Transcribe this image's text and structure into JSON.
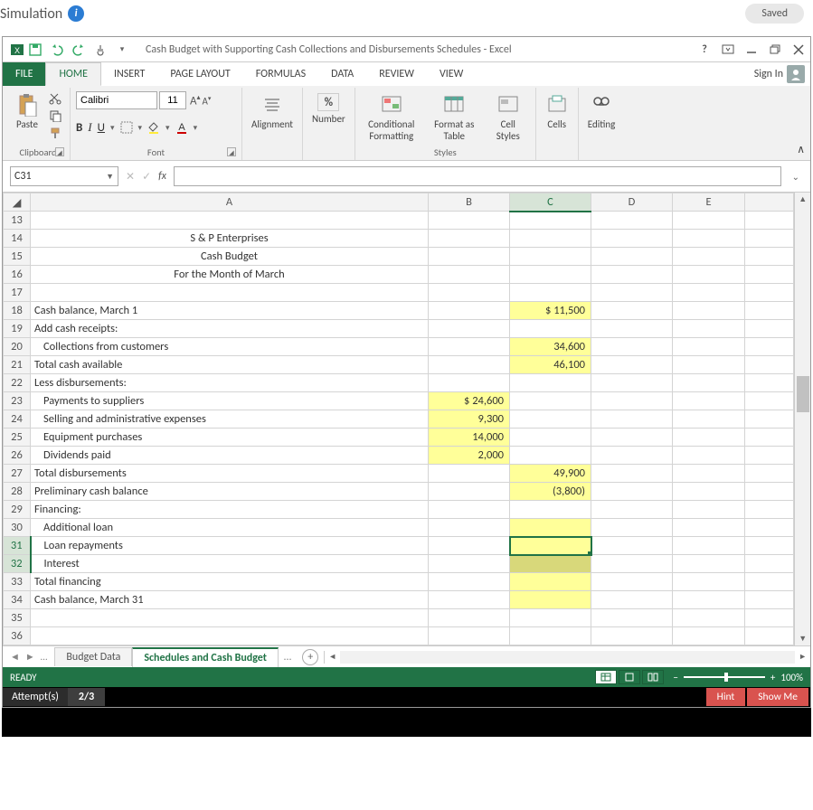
{
  "page": {
    "title": "Simulation",
    "saved_label": "Saved"
  },
  "titlebar": {
    "doc_title": "Cash Budget with Supporting Cash Collections and Disbursements Schedules - Excel"
  },
  "ribbon_tabs": {
    "file": "FILE",
    "home": "HOME",
    "insert": "INSERT",
    "page_layout": "PAGE LAYOUT",
    "formulas": "FORMULAS",
    "data": "DATA",
    "review": "REVIEW",
    "view": "VIEW",
    "sign_in": "Sign In"
  },
  "ribbon": {
    "clipboard": {
      "paste": "Paste",
      "group_label": "Clipboard"
    },
    "font": {
      "name": "Calibri",
      "size": "11",
      "group_label": "Font"
    },
    "alignment": {
      "label": "Alignment"
    },
    "number": {
      "label": "Number",
      "percent": "%"
    },
    "styles": {
      "cond": "Conditional Formatting",
      "table": "Format as Table",
      "cell": "Cell Styles",
      "group_label": "Styles"
    },
    "cells": {
      "label": "Cells"
    },
    "editing": {
      "label": "Editing"
    }
  },
  "formula_bar": {
    "name_box": "C31",
    "formula": ""
  },
  "columns": [
    "A",
    "B",
    "C",
    "D",
    "E"
  ],
  "active_col_index": 2,
  "rows": [
    {
      "n": 13,
      "a": "",
      "b": "",
      "c": "",
      "d": "",
      "e": ""
    },
    {
      "n": 14,
      "a": "S & P Enterprises",
      "a_center": true,
      "b": "",
      "c": "",
      "d": "",
      "e": ""
    },
    {
      "n": 15,
      "a": "Cash Budget",
      "a_center": true,
      "b": "",
      "c": "",
      "d": "",
      "e": ""
    },
    {
      "n": 16,
      "a": "For the Month of March",
      "a_center": true,
      "b": "",
      "c": "",
      "d": "",
      "e": ""
    },
    {
      "n": 17,
      "a": "",
      "b": "",
      "c": "",
      "d": "",
      "e": ""
    },
    {
      "n": 18,
      "a": "Cash balance, March 1",
      "b": "",
      "c": "$      11,500",
      "c_hl": true,
      "d": "",
      "e": ""
    },
    {
      "n": 19,
      "a": "Add cash receipts:",
      "b": "",
      "c": "",
      "d": "",
      "e": ""
    },
    {
      "n": 20,
      "a": "Collections from customers",
      "a_indent": true,
      "b": "",
      "c": "34,600",
      "c_hl": true,
      "d": "",
      "e": ""
    },
    {
      "n": 21,
      "a": "Total cash available",
      "b": "",
      "c": "46,100",
      "c_hl": true,
      "d": "",
      "e": ""
    },
    {
      "n": 22,
      "a": "Less disbursements:",
      "b": "",
      "c": "",
      "d": "",
      "e": ""
    },
    {
      "n": 23,
      "a": "Payments to suppliers",
      "a_indent": true,
      "b": "$     24,600",
      "b_hl": true,
      "c": "",
      "d": "",
      "e": ""
    },
    {
      "n": 24,
      "a": "Selling and administrative expenses",
      "a_indent": true,
      "b": "9,300",
      "b_hl": true,
      "c": "",
      "d": "",
      "e": ""
    },
    {
      "n": 25,
      "a": "Equipment purchases",
      "a_indent": true,
      "b": "14,000",
      "b_hl": true,
      "c": "",
      "d": "",
      "e": ""
    },
    {
      "n": 26,
      "a": "Dividends paid",
      "a_indent": true,
      "b": "2,000",
      "b_hl": true,
      "c": "",
      "d": "",
      "e": ""
    },
    {
      "n": 27,
      "a": "Total disbursements",
      "b": "",
      "c": "49,900",
      "c_hl": true,
      "d": "",
      "e": ""
    },
    {
      "n": 28,
      "a": "Preliminary cash balance",
      "b": "",
      "c": "(3,800)",
      "c_hl": true,
      "d": "",
      "e": ""
    },
    {
      "n": 29,
      "a": "Financing:",
      "b": "",
      "c": "",
      "d": "",
      "e": ""
    },
    {
      "n": 30,
      "a": "Additional loan",
      "a_indent": true,
      "b": "",
      "c": "",
      "c_hl": true,
      "d": "",
      "e": ""
    },
    {
      "n": 31,
      "a": "Loan repayments",
      "a_indent": true,
      "b": "",
      "c": "",
      "c_hl": true,
      "c_active": true,
      "d": "",
      "e": "",
      "row_sel": true
    },
    {
      "n": 32,
      "a": "Interest",
      "a_indent": true,
      "b": "",
      "c": "",
      "c_hl_dark": true,
      "d": "",
      "e": "",
      "row_sel": true
    },
    {
      "n": 33,
      "a": "Total financing",
      "b": "",
      "c": "",
      "c_hl": true,
      "d": "",
      "e": ""
    },
    {
      "n": 34,
      "a": "Cash balance, March 31",
      "b": "",
      "c": "",
      "c_hl": true,
      "d": "",
      "e": ""
    },
    {
      "n": 35,
      "a": "",
      "b": "",
      "c": "",
      "d": "",
      "e": ""
    },
    {
      "n": 36,
      "a": "",
      "b": "",
      "c": "",
      "d": "",
      "e": ""
    }
  ],
  "sheet_tabs": {
    "tab1": "Budget Data",
    "tab2": "Schedules and Cash Budget",
    "ellipsis": "…"
  },
  "status_bar": {
    "ready": "READY",
    "zoom": "100%"
  },
  "attempts": {
    "label": "Attempt(s)",
    "count": "2/3",
    "hint": "Hint",
    "show_me": "Show Me"
  },
  "chart_data": {
    "type": "table",
    "title": "S & P Enterprises — Cash Budget — For the Month of March",
    "rows": [
      {
        "label": "Cash balance, March 1",
        "detail": null,
        "total": 11500
      },
      {
        "label": "Collections from customers",
        "detail": null,
        "total": 34600
      },
      {
        "label": "Total cash available",
        "detail": null,
        "total": 46100
      },
      {
        "label": "Payments to suppliers",
        "detail": 24600,
        "total": null
      },
      {
        "label": "Selling and administrative expenses",
        "detail": 9300,
        "total": null
      },
      {
        "label": "Equipment purchases",
        "detail": 14000,
        "total": null
      },
      {
        "label": "Dividends paid",
        "detail": 2000,
        "total": null
      },
      {
        "label": "Total disbursements",
        "detail": null,
        "total": 49900
      },
      {
        "label": "Preliminary cash balance",
        "detail": null,
        "total": -3800
      },
      {
        "label": "Additional loan",
        "detail": null,
        "total": null
      },
      {
        "label": "Loan repayments",
        "detail": null,
        "total": null
      },
      {
        "label": "Interest",
        "detail": null,
        "total": null
      },
      {
        "label": "Total financing",
        "detail": null,
        "total": null
      },
      {
        "label": "Cash balance, March 31",
        "detail": null,
        "total": null
      }
    ]
  }
}
